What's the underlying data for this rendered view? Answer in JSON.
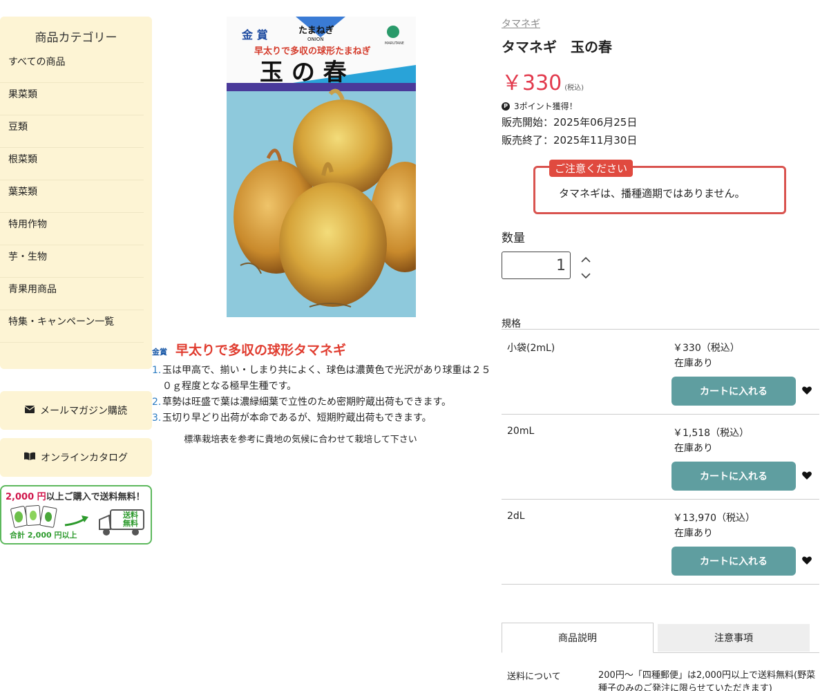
{
  "sidebar": {
    "title": "商品カテゴリー",
    "categories": [
      "すべての商品",
      "果菜類",
      "豆類",
      "根菜類",
      "葉菜類",
      "特用作物",
      "芋・生物",
      "青果用商品",
      "特集・キャンペーン一覧"
    ],
    "mail_magazine": "メールマガジン購読",
    "online_catalog": "オンラインカタログ",
    "banner": {
      "amount": "2,000 円",
      "rest": "以上ご購入で送料無料！",
      "sub": "合計 2,000 円以上",
      "truck_label_1": "送料",
      "truck_label_2": "無料"
    }
  },
  "product_image": {
    "award": "金 賞",
    "kana": "たまねぎ",
    "en": "ONION",
    "catch": "早太りで多収の球形たまねぎ",
    "name": "玉 の 春",
    "maker": "MARUTANE"
  },
  "description": {
    "badge": "金賞",
    "title": "早太りで多収の球形タマネギ",
    "items": [
      "玉は甲高で、揃い・しまり共によく、球色は濃黄色で光沢があり球重は２５０ｇ程度となる極早生種です。",
      "草勢は旺盛で葉は濃緑細葉で立性のため密期貯蔵出荷もできます。",
      "玉切り早どり出荷が本命であるが、短期貯蔵出荷もできます。"
    ],
    "note": "標準栽培表を参考に貴地の気候に合わせて栽培して下さい"
  },
  "product": {
    "breadcrumb": "タマネギ",
    "title": "タマネギ　玉の春",
    "price": "￥330",
    "tax": "(税込)",
    "points": "3ポイント獲得！",
    "sale_start": "販売開始：2025年06月25日",
    "sale_end": "販売終了：2025年11月30日"
  },
  "notice": {
    "tag": "ご注意ください",
    "text": "タマネギは、播種適期ではありません。"
  },
  "quantity": {
    "label": "数量",
    "value": "1"
  },
  "specs": {
    "label": "規格",
    "rows": [
      {
        "name": "小袋(2mL)",
        "price": "￥330（税込）",
        "stock": "在庫あり",
        "button": "カートに入れる"
      },
      {
        "name": "20mL",
        "price": "￥1,518（税込）",
        "stock": "在庫あり",
        "button": "カートに入れる"
      },
      {
        "name": "2dL",
        "price": "￥13,970（税込）",
        "stock": "在庫あり",
        "button": "カートに入れる"
      }
    ]
  },
  "tabs": [
    "商品説明",
    "注意事項"
  ],
  "shipping": {
    "label": "送料について",
    "text": "200円〜「四種郵便」は2,000円以上で送料無料(野菜種子のみのご発注に限らせていただきます)"
  }
}
